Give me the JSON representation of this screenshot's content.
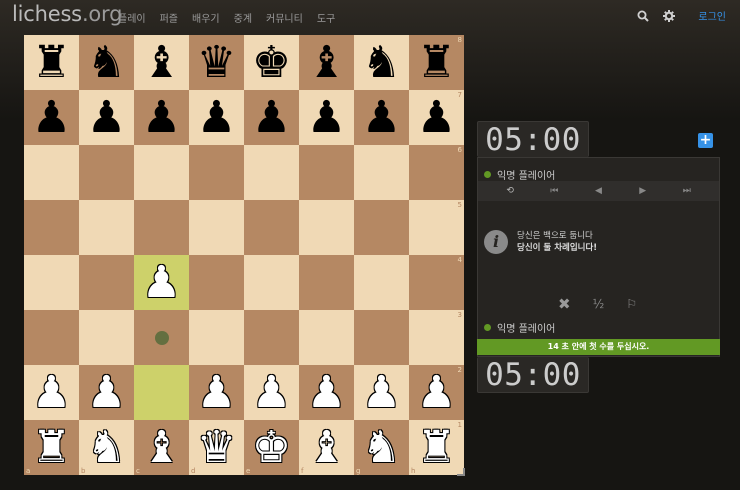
{
  "header": {
    "logo_main": "lichess",
    "logo_tld": ".org",
    "nav": [
      "플레이",
      "퍼즐",
      "배우기",
      "중계",
      "커뮤니티",
      "도구"
    ],
    "login": "로그인"
  },
  "board": {
    "orientation": "white",
    "pieces": [
      [
        "br",
        "bn",
        "bb",
        "bq",
        "bk",
        "bb",
        "bn",
        "br"
      ],
      [
        "bp",
        "bp",
        "bp",
        "bp",
        "bp",
        "bp",
        "bp",
        "bp"
      ],
      [
        "",
        "",
        "",
        "",
        "",
        "",
        "",
        ""
      ],
      [
        "",
        "",
        "",
        "",
        "",
        "",
        "",
        ""
      ],
      [
        "",
        "",
        "wp",
        "",
        "",
        "",
        "",
        ""
      ],
      [
        "",
        "",
        "",
        "",
        "",
        "",
        "",
        ""
      ],
      [
        "wp",
        "wp",
        "",
        "wp",
        "wp",
        "wp",
        "wp",
        "wp"
      ],
      [
        "wr",
        "wn",
        "wb",
        "wq",
        "wk",
        "wb",
        "wn",
        "wr"
      ]
    ],
    "ranks": [
      "8",
      "7",
      "6",
      "5",
      "4",
      "3",
      "2",
      "1"
    ],
    "files": [
      "a",
      "b",
      "c",
      "d",
      "e",
      "f",
      "g",
      "h"
    ],
    "last_move": [
      "c2",
      "c4"
    ],
    "move_dest": [
      "c3"
    ]
  },
  "clock_top": "05:00",
  "clock_bottom": "05:00",
  "player_top": "익명 플레이어",
  "player_bottom": "익명 플레이어",
  "controls": [
    "⟲",
    "⏮",
    "◀",
    "▶",
    "⏭"
  ],
  "message": {
    "line1": "당신은 백으로 둡니다",
    "line2": "당신이 둘 차례입니다!"
  },
  "actions": {
    "abort": "✖",
    "draw": "½",
    "resign": "⚐"
  },
  "first_move_notice": "14 초 안에 첫 수를 두십시오.",
  "colors": {
    "light_square": "#f0d9b5",
    "dark_square": "#b58863",
    "accent_green": "#629924",
    "accent_blue": "#3692e7"
  }
}
